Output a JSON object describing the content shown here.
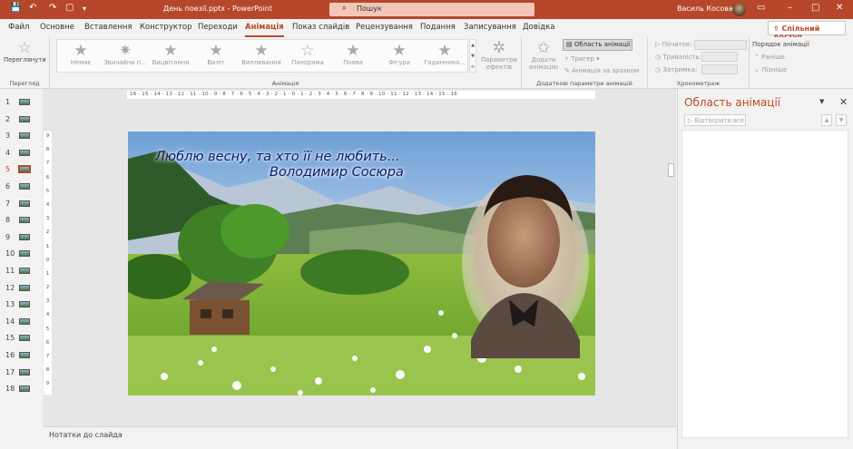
{
  "titlebar": {
    "document_title": "День поезії.pptx - PowerPoint",
    "search_placeholder": "Пошук",
    "user_name": "Василь Косован",
    "minimize_glyph": "–",
    "maximize_glyph": "□",
    "close_glyph": "✕",
    "restore_glyph": "▭",
    "save_glyph": "💾",
    "undo_glyph": "↶",
    "redo_glyph": "↷",
    "start_glyph": "▢",
    "customize_glyph": "▾"
  },
  "tabs": [
    "Файл",
    "Основне",
    "Вставлення",
    "Конструктор",
    "Переходи",
    "Анімація",
    "Показ слайдів",
    "Рецензування",
    "Подання",
    "Записування",
    "Довідка"
  ],
  "active_tab_index": 5,
  "share_label": "Спільний доступ",
  "ribbon": {
    "preview": {
      "label": "Переглянути",
      "group": "Перегляд"
    },
    "animations": [
      "Немає",
      "Звичайна п...",
      "Вицвітання",
      "Виліт",
      "Випливання",
      "Панорама",
      "Поява",
      "Фігура",
      "Годиннико..."
    ],
    "animation_group": "Анімація",
    "effect_options": "Параметри ефектів",
    "add_animation": "Додати анімацію",
    "animation_pane_btn": "Область анімації",
    "trigger": "Тригер",
    "animation_painter": "Анімація за зразком",
    "advanced_group": "Додаткові параметри анімацій",
    "start_label": "Початок:",
    "duration_label": "Тривалість:",
    "delay_label": "Затримка:",
    "reorder_label": "Порядок анімації",
    "move_earlier": "Раніше",
    "move_later": "Пізніше",
    "timing_group": "Хронометраж"
  },
  "slides": {
    "numbers": [
      "1",
      "2",
      "3",
      "4",
      "5",
      "6",
      "7",
      "8",
      "9",
      "10",
      "11",
      "12",
      "13",
      "14",
      "15",
      "16",
      "17",
      "18"
    ],
    "selected_index": 4
  },
  "ruler_text": "16 · 15 · 14 · 13 · 12 · 11 · 10 · 9 · 8 · 7 · 6 · 5 · 4 · 3 · 2 · 1 · 0 · 1 · 2 · 3 · 4 · 5 · 6 · 7 · 8 · 9 · 10 · 11 · 12 · 13 · 14 · 15 · 16",
  "vruler": [
    "9",
    "8",
    "7",
    "6",
    "5",
    "4",
    "3",
    "2",
    "1",
    "0",
    "1",
    "2",
    "3",
    "4",
    "5",
    "6",
    "7",
    "8",
    "9"
  ],
  "slide": {
    "line1": "Люблю весну, та хто її не любить...",
    "line2": "Володимир Сосюра"
  },
  "notes_label": "Нотатки до слайда",
  "pane": {
    "title": "Область анімації",
    "play_button": "Відтворити все"
  },
  "colors": {
    "accent": "#b7472a",
    "slide_text": "#0a1c6e"
  }
}
